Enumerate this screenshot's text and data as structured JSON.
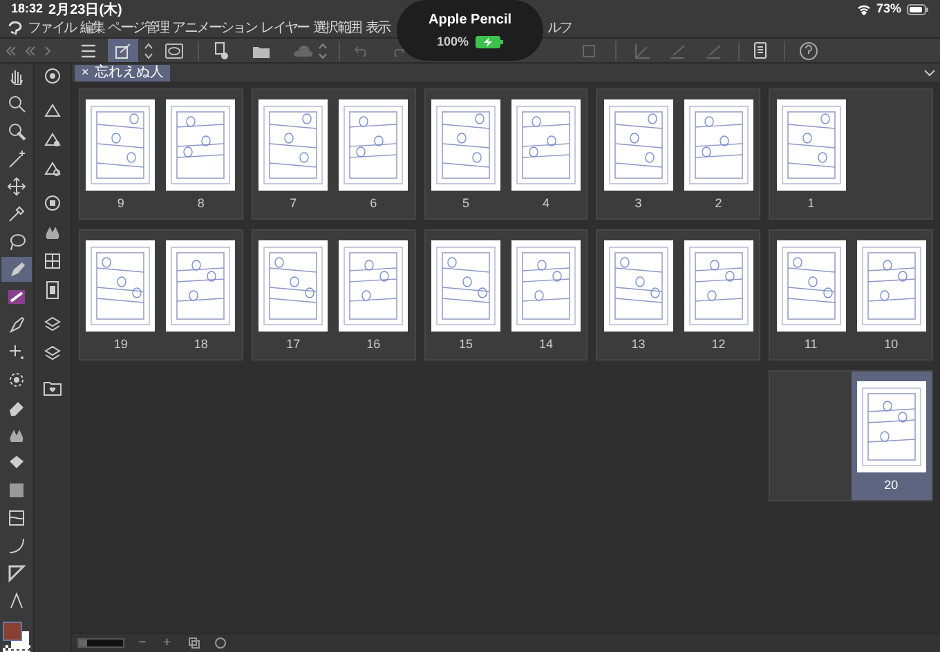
{
  "status_bar": {
    "time": "18:32",
    "date": "2月23日(木)",
    "battery": "73%"
  },
  "pencil_popup": {
    "title": "Apple Pencil",
    "charge": "100%"
  },
  "menu": [
    "ファイル",
    "編集",
    "ページ管理",
    "アニメーション",
    "レイヤー",
    "選択範囲",
    "表示",
    "ルフ"
  ],
  "document_tab": {
    "close": "×",
    "title": "忘れえぬ人"
  },
  "page_rows": [
    [
      {
        "pages": [
          {
            "kind": "left",
            "number": "9",
            "selected": false
          },
          {
            "kind": "right",
            "number": "8",
            "selected": false
          }
        ]
      },
      {
        "pages": [
          {
            "kind": "left",
            "number": "7",
            "selected": false
          },
          {
            "kind": "right",
            "number": "6",
            "selected": false
          }
        ]
      },
      {
        "pages": [
          {
            "kind": "left",
            "number": "5",
            "selected": false
          },
          {
            "kind": "right",
            "number": "4",
            "selected": false
          }
        ]
      },
      {
        "pages": [
          {
            "kind": "left",
            "number": "3",
            "selected": false
          },
          {
            "kind": "right",
            "number": "2",
            "selected": false
          }
        ]
      },
      {
        "pages": [
          {
            "kind": "left",
            "number": "1",
            "selected": false
          }
        ]
      }
    ],
    [
      {
        "pages": [
          {
            "kind": "left",
            "number": "19",
            "selected": false
          },
          {
            "kind": "right",
            "number": "18",
            "selected": false
          }
        ]
      },
      {
        "pages": [
          {
            "kind": "left",
            "number": "17",
            "selected": false
          },
          {
            "kind": "right",
            "number": "16",
            "selected": false
          }
        ]
      },
      {
        "pages": [
          {
            "kind": "left",
            "number": "15",
            "selected": false
          },
          {
            "kind": "right",
            "number": "14",
            "selected": false
          }
        ]
      },
      {
        "pages": [
          {
            "kind": "left",
            "number": "13",
            "selected": false
          },
          {
            "kind": "right",
            "number": "12",
            "selected": false
          }
        ]
      },
      {
        "pages": [
          {
            "kind": "left",
            "number": "11",
            "selected": false
          },
          {
            "kind": "right",
            "number": "10",
            "selected": false
          }
        ]
      }
    ],
    [
      {
        "pages": [
          {
            "kind": "right",
            "number": "20",
            "selected": true
          }
        ]
      }
    ]
  ],
  "zoom_bar": {
    "minus": "−",
    "plus": "+",
    "level": 0.2
  }
}
